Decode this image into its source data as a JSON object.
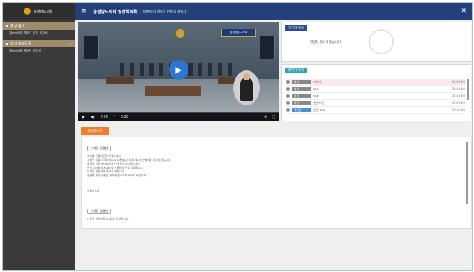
{
  "app": {
    "logo_text": "충청남도의회",
    "title": "충청남도의회 영상회의록",
    "subtitle": "제000회 제0차 본회의 제0차"
  },
  "sidebar": {
    "groups": [
      {
        "label": "영상 검색",
        "subs": [
          "제0000회 제0차 본회 회의록"
        ]
      },
      {
        "label": "회의 정보목록",
        "subs": [
          "제0000회 제0차 회의록"
        ]
      }
    ]
  },
  "video": {
    "banner": "충청남도의회",
    "time": "0:00",
    "duration": "0:00",
    "progress": 0
  },
  "panels": {
    "info_tab": "발언자 정보",
    "info_message": "발언자 정보가 없습니다.",
    "speaker_tab": "발언자 목록",
    "speakers": [
      {
        "name": "의장",
        "text": "개회식",
        "time": "00:00:00",
        "active": true
      },
      {
        "name": "의원",
        "text": "보고",
        "time": "00:00:00",
        "active": false
      },
      {
        "name": "의원",
        "text": "대표",
        "time": "00:00:00",
        "active": false
      },
      {
        "name": "의원",
        "text": "찬반토론",
        "time": "00:00:00",
        "active": false
      },
      {
        "name": "위원장",
        "text": "안건 보고",
        "time": "00:00:00",
        "active": false
      }
    ]
  },
  "minutes": {
    "tab_label": "회의록보기",
    "speaker1": "○의장 김명선",
    "lines": [
      "회의를 진행하도록 하겠습니다.",
      "성원이 되었으므로 제000회 충청남도의회 제0차 본회의를 개회하겠습니다.",
      "회의를 시작하기에 앞서 안내 말씀드리겠습니다.",
      "먼저 의사일정 제1항 회기 결정의 건을 상정합니다.",
      "의석을 정돈하여 주시기 바랍니다.",
      "원활한 회의 진행을 위하여 협조하여 주시기 바랍니다."
    ],
    "note": "의회사무처",
    "speaker2": "○의장 김명선",
    "lines2": [
      "다음은 의사일정 제2항을 상정합니다."
    ]
  }
}
